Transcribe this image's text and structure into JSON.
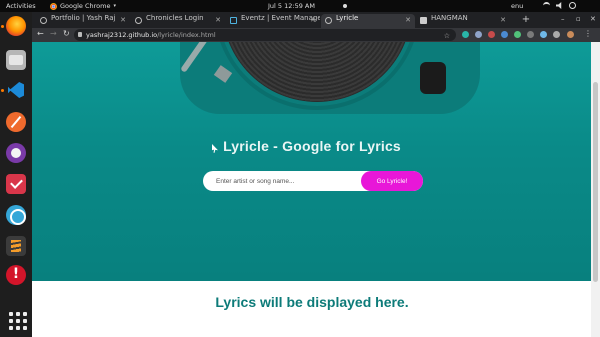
{
  "system_bar": {
    "activities": "Activities",
    "app_name": "Google Chrome",
    "clock": "Jul 5  12:59 AM",
    "language": "enu"
  },
  "dock": {
    "apps": [
      "firefox-icon",
      "files-icon",
      "vscode-icon",
      "postman-icon",
      "github-desktop-icon",
      "todo-icon",
      "network-icon",
      "sublime-text-icon",
      "alert-icon",
      "show-apps-icon"
    ]
  },
  "browser": {
    "tabs": [
      {
        "title": "Portfolio | Yash Raj",
        "active": false
      },
      {
        "title": "Chronicles Login",
        "active": false
      },
      {
        "title": "Eventz | Event Management",
        "active": false
      },
      {
        "title": "Lyricle",
        "active": true
      },
      {
        "title": "HANGMAN",
        "active": false
      }
    ],
    "url_host": "yashraj2312.github.io",
    "url_path": "/lyricle/index.html"
  },
  "page": {
    "title": "Lyricle - Google for Lyrics",
    "search": {
      "placeholder": "Enter artist or song name...",
      "value": ""
    },
    "search_button": "Go Lyricle!",
    "results_message": "Lyrics will be displayed here."
  },
  "colors": {
    "hero_teal": "#0c8d8b",
    "accent_magenta": "#e817d8",
    "message_teal": "#0d7b79"
  }
}
